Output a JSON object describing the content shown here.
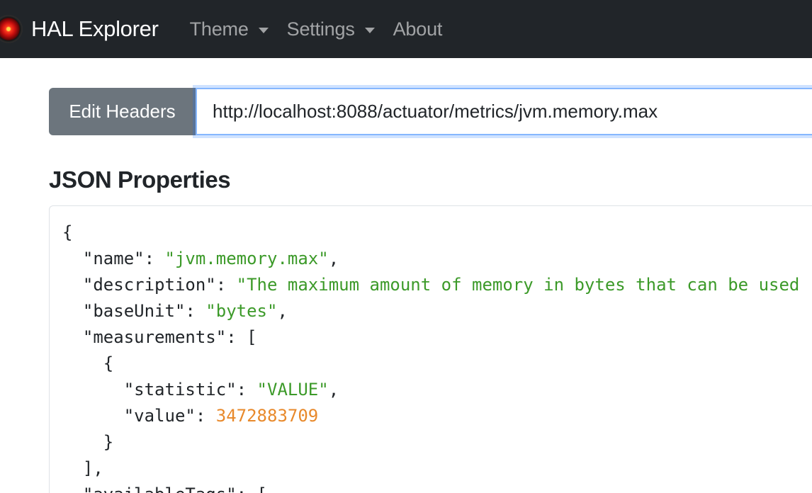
{
  "navbar": {
    "brand": "HAL Explorer",
    "items": [
      {
        "label": "Theme",
        "dropdown": true
      },
      {
        "label": "Settings",
        "dropdown": true
      },
      {
        "label": "About",
        "dropdown": false
      }
    ]
  },
  "request": {
    "edit_headers_label": "Edit Headers",
    "url_value": "http://localhost:8088/actuator/metrics/jvm.memory.max"
  },
  "json_section": {
    "title": "JSON Properties",
    "lines": [
      {
        "indent": "",
        "key": "",
        "value": "{",
        "type": "punct",
        "tail": ""
      },
      {
        "indent": "  ",
        "key": "\"name\": ",
        "value": "\"jvm.memory.max\"",
        "type": "string",
        "tail": ","
      },
      {
        "indent": "  ",
        "key": "\"description\": ",
        "value": "\"The maximum amount of memory in bytes that can be used",
        "type": "string",
        "tail": ""
      },
      {
        "indent": "  ",
        "key": "\"baseUnit\": ",
        "value": "\"bytes\"",
        "type": "string",
        "tail": ","
      },
      {
        "indent": "  ",
        "key": "\"measurements\": ",
        "value": "[",
        "type": "punct",
        "tail": ""
      },
      {
        "indent": "    ",
        "key": "",
        "value": "{",
        "type": "punct",
        "tail": ""
      },
      {
        "indent": "      ",
        "key": "\"statistic\": ",
        "value": "\"VALUE\"",
        "type": "string",
        "tail": ","
      },
      {
        "indent": "      ",
        "key": "\"value\": ",
        "value": "3472883709",
        "type": "number",
        "tail": ""
      },
      {
        "indent": "    ",
        "key": "",
        "value": "}",
        "type": "punct",
        "tail": ""
      },
      {
        "indent": "  ",
        "key": "",
        "value": "]",
        "type": "punct",
        "tail": ","
      },
      {
        "indent": "  ",
        "key": "\"availableTags\": ",
        "value": "[",
        "type": "punct",
        "tail": ""
      }
    ]
  },
  "colors": {
    "navbar_bg": "#212529",
    "button_bg": "#6c757d",
    "string": "#3c9a29",
    "number": "#e8892b"
  }
}
